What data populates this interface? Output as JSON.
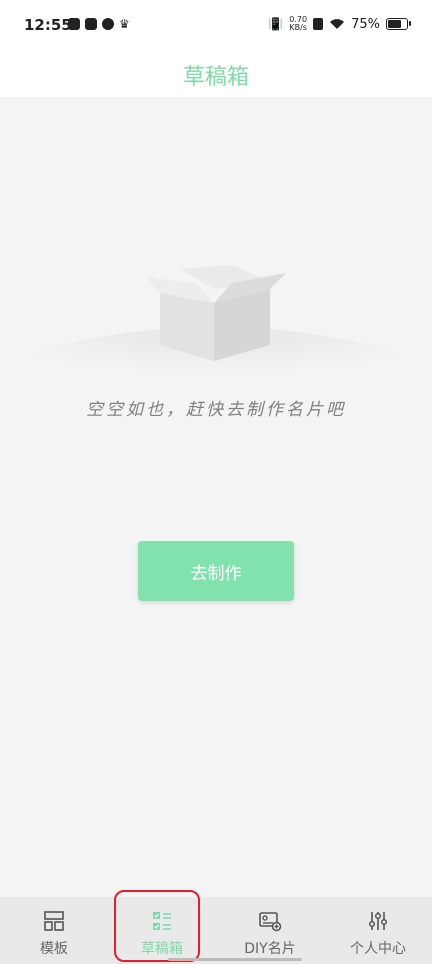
{
  "status_bar": {
    "time": "12:55",
    "net_speed": "0.70",
    "net_unit": "KB/s",
    "battery": "75%"
  },
  "header": {
    "title": "草稿箱"
  },
  "empty_state": {
    "message": "空空如也，赶快去制作名片吧",
    "button_label": "去制作"
  },
  "tabs": [
    {
      "label": "模板",
      "icon": "template-icon"
    },
    {
      "label": "草稿箱",
      "icon": "drafts-icon"
    },
    {
      "label": "DIY名片",
      "icon": "diy-card-icon"
    },
    {
      "label": "个人中心",
      "icon": "settings-sliders-icon"
    }
  ],
  "colors": {
    "accent": "#7fd9a6",
    "button": "#82e2ad",
    "highlight_ring": "#e0202a"
  }
}
